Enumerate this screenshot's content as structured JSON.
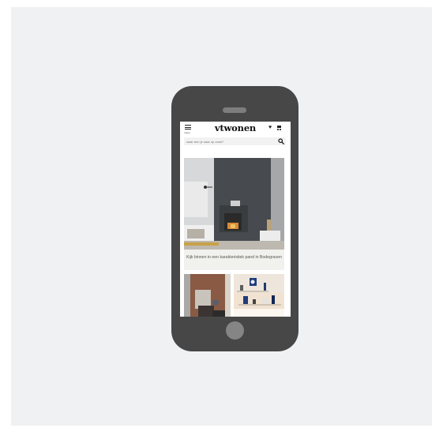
{
  "app": {
    "brand": "vtwonen",
    "menu_label": "menu"
  },
  "search": {
    "placeholder": "waar ben je naar op zoek?"
  },
  "header_icons": [
    "heart-icon",
    "cart-icon",
    "search-icon",
    "menu-icon"
  ],
  "feed": {
    "hero": {
      "badge_text": "",
      "caption": "Kijk binnen in een karakteristiek pand in Bodegraven"
    },
    "thumbnails": [
      {
        "name": "brick-wall-interior"
      },
      {
        "name": "shelf-with-vases"
      }
    ]
  },
  "colors": {
    "background": "#f0f1f3",
    "phone_body": "#474747",
    "caption_bg": "#f1f1ee",
    "accent_badge": "#c8a24a"
  }
}
